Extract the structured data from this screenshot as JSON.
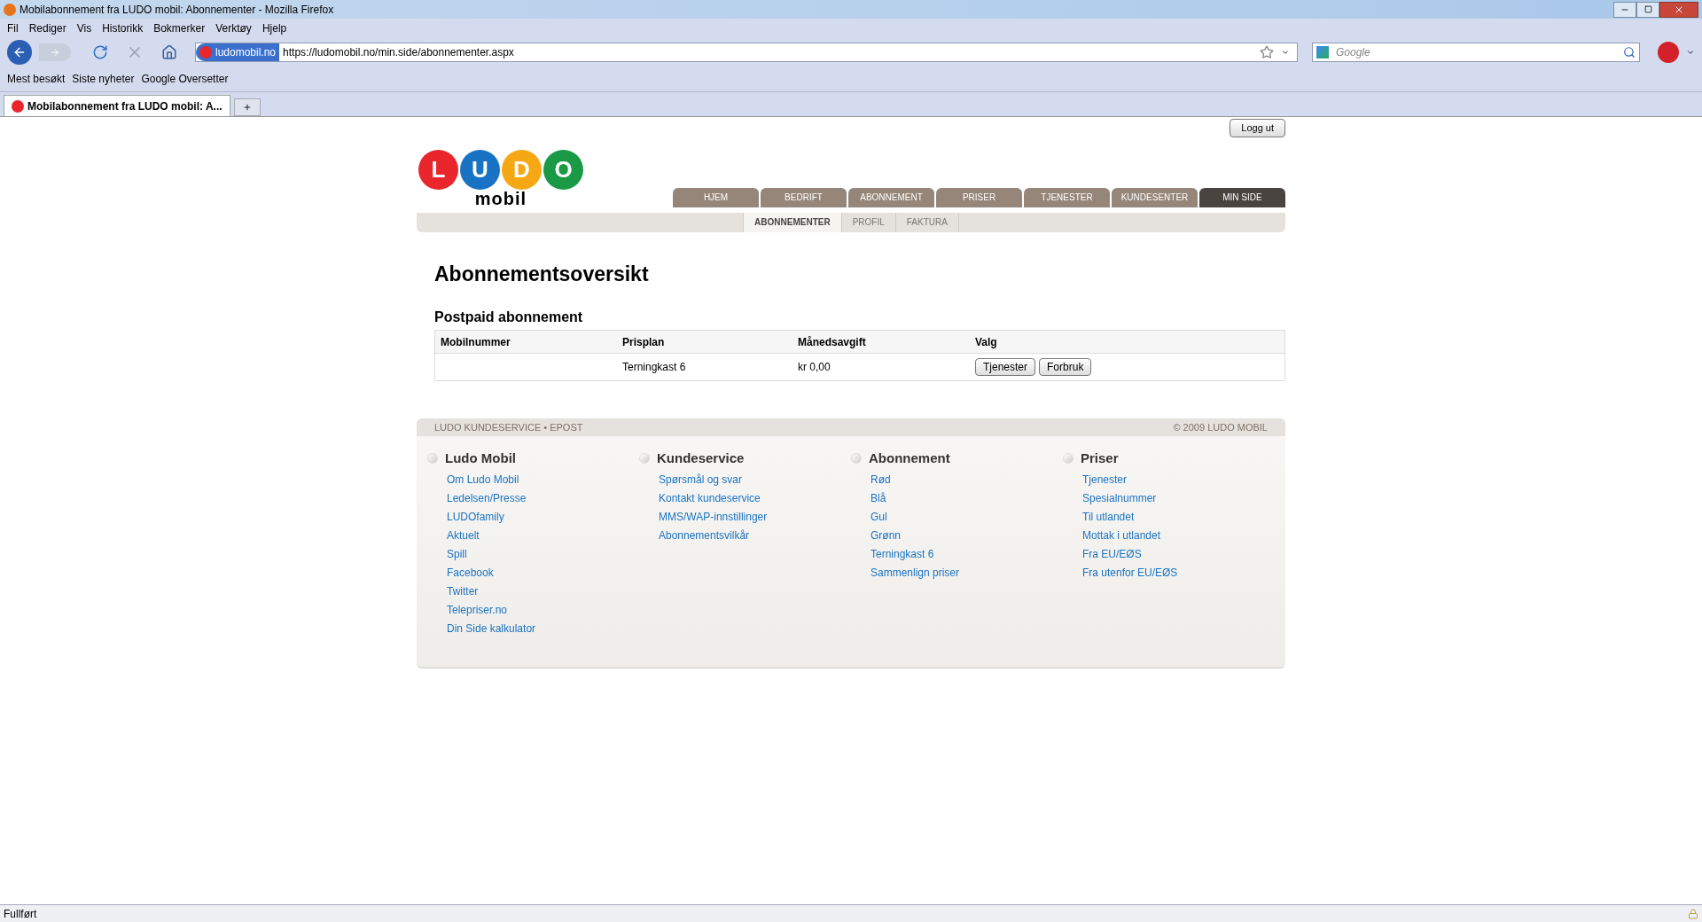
{
  "window": {
    "title": "Mobilabonnement fra LUDO mobil: Abonnementer - Mozilla Firefox"
  },
  "menu": [
    "Fil",
    "Rediger",
    "Vis",
    "Historikk",
    "Bokmerker",
    "Verktøy",
    "Hjelp"
  ],
  "address_bar": {
    "site": "ludomobil.no",
    "url": "https://ludomobil.no/min.side/abonnementer.aspx"
  },
  "search": {
    "placeholder": "Google"
  },
  "bookmarks": [
    "Mest besøkt",
    "Siste nyheter",
    "Google Oversetter"
  ],
  "tabs": [
    {
      "label": "Mobilabonnement fra LUDO mobil: A...",
      "selected": true
    }
  ],
  "page": {
    "logout": "Logg ut",
    "logo": {
      "letters": [
        {
          "char": "L",
          "color": "#e8262c"
        },
        {
          "char": "U",
          "color": "#1873c4"
        },
        {
          "char": "D",
          "color": "#f5a814"
        },
        {
          "char": "O",
          "color": "#1a9a45"
        }
      ],
      "sub": "mobil"
    },
    "nav": [
      {
        "label": "HJEM",
        "selected": false
      },
      {
        "label": "BEDRIFT",
        "selected": false
      },
      {
        "label": "ABONNEMENT",
        "selected": false
      },
      {
        "label": "PRISER",
        "selected": false
      },
      {
        "label": "TJENESTER",
        "selected": false
      },
      {
        "label": "KUNDESENTER",
        "selected": false
      },
      {
        "label": "MIN SIDE",
        "selected": true
      }
    ],
    "subnav": [
      {
        "label": "ABONNEMENTER",
        "selected": true
      },
      {
        "label": "PROFIL",
        "selected": false
      },
      {
        "label": "FAKTURA",
        "selected": false
      }
    ],
    "heading": "Abonnementsoversikt",
    "section": "Postpaid abonnement",
    "table": {
      "columns": [
        "Mobilnummer",
        "Prisplan",
        "Månedsavgift",
        "Valg"
      ],
      "rows": [
        {
          "prisplan": "Terningkast 6",
          "avgift": "kr 0,00",
          "buttons": [
            "Tjenester",
            "Forbruk"
          ]
        }
      ]
    },
    "footer": {
      "left": "LUDO KUNDESERVICE • EPOST",
      "right": "© 2009 LUDO MOBIL",
      "columns": [
        {
          "title": "Ludo Mobil",
          "links": [
            "Om Ludo Mobil",
            "Ledelsen/Presse",
            "LUDOfamily",
            "Aktuelt",
            "Spill",
            "Facebook",
            "Twitter",
            "Telepriser.no",
            "Din Side kalkulator"
          ]
        },
        {
          "title": "Kundeservice",
          "links": [
            "Spørsmål og svar",
            "Kontakt kundeservice",
            "MMS/WAP-innstillinger",
            "Abonnementsvilkår"
          ]
        },
        {
          "title": "Abonnement",
          "links": [
            "Rød",
            "Blå",
            "Gul",
            "Grønn",
            "Terningkast 6",
            "Sammenlign priser"
          ]
        },
        {
          "title": "Priser",
          "links": [
            "Tjenester",
            "Spesialnummer",
            "Til utlandet",
            "Mottak i utlandet",
            "Fra EU/EØS",
            "Fra utenfor EU/EØS"
          ]
        }
      ]
    }
  },
  "status_bar": "Fullført"
}
